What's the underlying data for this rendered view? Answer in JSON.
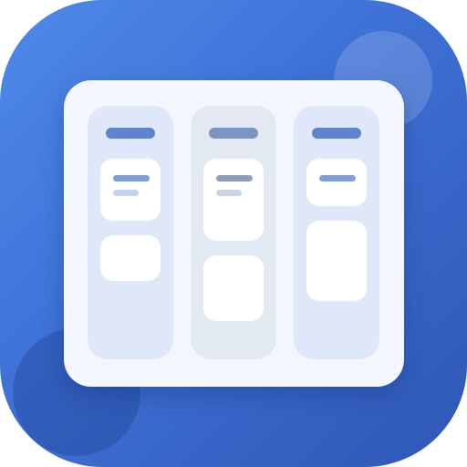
{
  "app_icon": {
    "name": "kanban-board-icon",
    "colors": {
      "gradient_start": "#4e8ae8",
      "gradient_end": "#2f57b5",
      "board": "#f3f7fd",
      "column": "#dee8f8",
      "card": "#ffffff",
      "header_bar": "#5d85cf"
    },
    "columns": [
      {
        "name": "column-1",
        "cards": 2
      },
      {
        "name": "column-2",
        "cards": 2
      },
      {
        "name": "column-3",
        "cards": 2
      }
    ]
  }
}
